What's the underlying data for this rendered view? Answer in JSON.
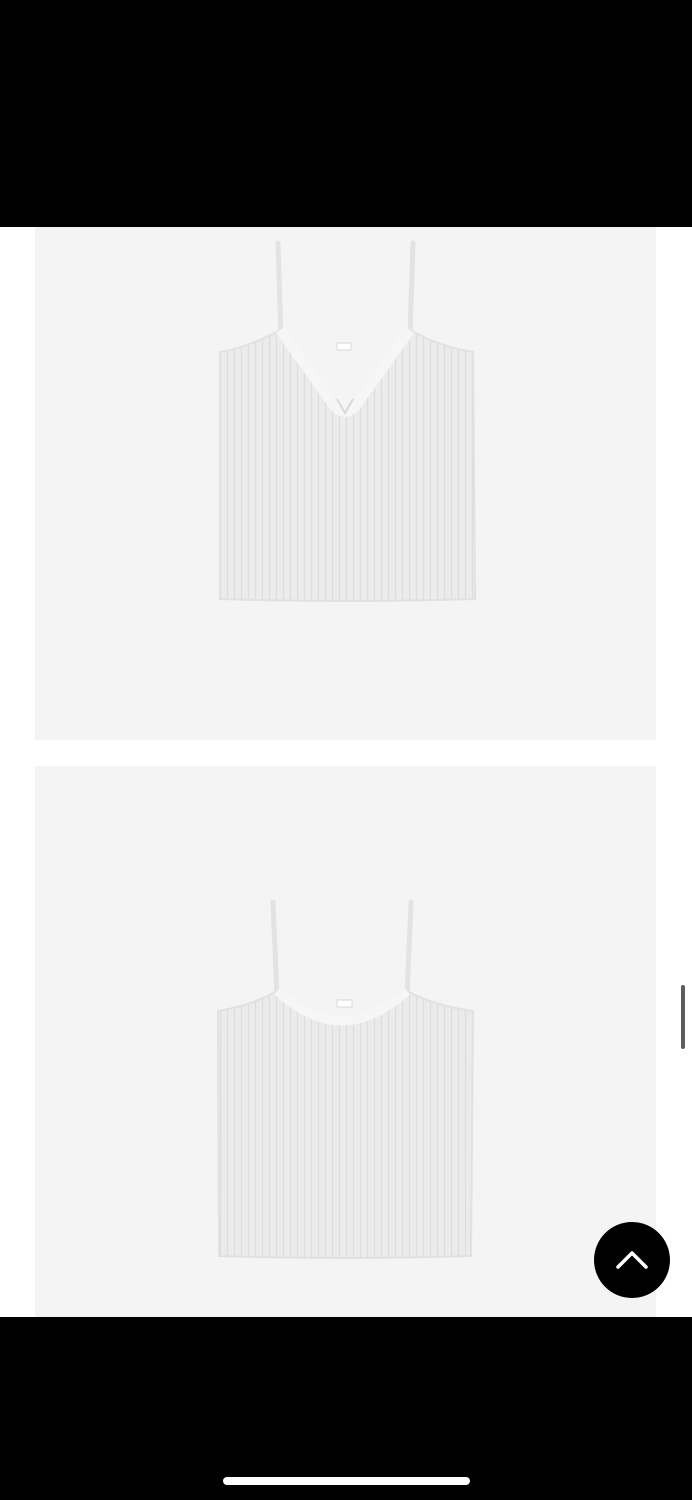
{
  "colors": {
    "frame": "#000000",
    "page_background": "#ffffff",
    "image_background": "#f4f4f4",
    "garment": "#e9eaea",
    "scroll_button": "#000000"
  },
  "gallery": {
    "images": [
      {
        "alt": "",
        "style": "ribbed camisole with ruched v-neck, front view"
      },
      {
        "alt": "",
        "style": "ribbed camisole with scoop neck, back view"
      }
    ]
  },
  "icons": {
    "back_to_top": "chevron-up-icon",
    "label_tag": "label-tag-icon"
  }
}
